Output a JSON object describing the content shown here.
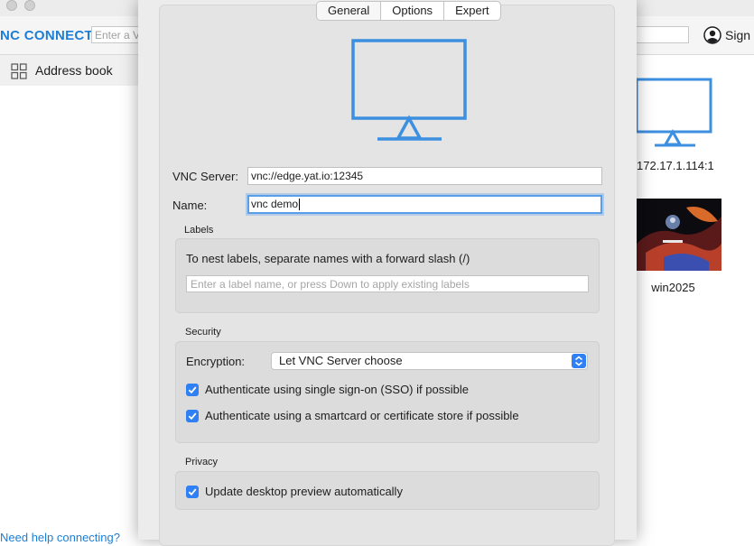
{
  "app": {
    "logo_text": "NC CONNECT",
    "search_placeholder": "Enter a V",
    "signin_label": "Sign i",
    "sidebar": {
      "address_book_label": "Address book",
      "bottom_link": "Need help connecting?"
    },
    "tiles": [
      {
        "label": "172.17.1.114:1"
      },
      {
        "label": "win2025"
      }
    ]
  },
  "dialog": {
    "tabs": [
      {
        "label": "General",
        "active": true
      },
      {
        "label": "Options",
        "active": false
      },
      {
        "label": "Expert",
        "active": false
      }
    ],
    "vnc_server": {
      "label": "VNC Server:",
      "value": "vnc://edge.yat.io:12345"
    },
    "name": {
      "label": "Name:",
      "value": "vnc demo"
    },
    "labels_section": {
      "title": "Labels",
      "hint": "To nest labels, separate names with a forward slash (/)",
      "input_placeholder": "Enter a label name, or press Down to apply existing labels"
    },
    "security_section": {
      "title": "Security",
      "encryption_label": "Encryption:",
      "encryption_value": "Let VNC Server choose",
      "sso_label": "Authenticate using single sign-on (SSO) if possible",
      "sso_checked": true,
      "smartcard_label": "Authenticate using a smartcard or certificate store if possible",
      "smartcard_checked": true
    },
    "privacy_section": {
      "title": "Privacy",
      "preview_label": "Update desktop preview automatically",
      "preview_checked": true
    }
  },
  "colors": {
    "accent": "#2f7ff5",
    "monitor": "#3d8fe0",
    "logo": "#1c7ed6"
  }
}
